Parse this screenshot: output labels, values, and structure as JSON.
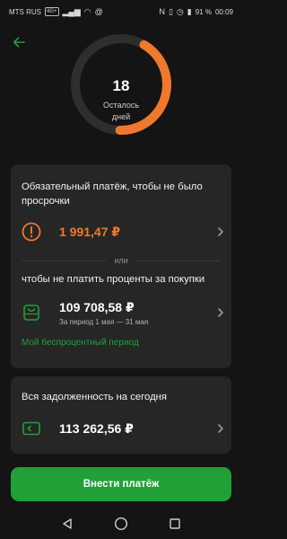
{
  "status_bar": {
    "carrier": "MTS RUS",
    "network_badge": "4G+",
    "battery": "91 %",
    "time": "00:09"
  },
  "header": {
    "back_icon": "back-arrow-icon"
  },
  "countdown": {
    "days": "18",
    "label": "Осталось\nдней",
    "progress_fraction": 0.42,
    "progress_color": "#f0782c",
    "track_color": "#2e2e2e"
  },
  "mandatory": {
    "title": "Обязательный платёж, чтобы не было просрочки",
    "amount": "1 991,47 ₽",
    "icon": "warning-circle-icon",
    "accent_color": "#f0782c"
  },
  "divider_text": "или",
  "interest_free": {
    "title": "чтобы не платить проценты за покупки",
    "amount": "109 708,58 ₽",
    "period": "За период 1 мая — 31 мая",
    "icon": "shopping-bag-icon",
    "link": "Мой беспроцентный период"
  },
  "total_debt": {
    "title": "Вся задолженность на сегодня",
    "amount": "113 262,56 ₽",
    "icon": "card-icon"
  },
  "pay_button": "Внести платёж",
  "colors": {
    "brand_green": "#21a038",
    "orange": "#f0782c",
    "background": "#141414",
    "card": "#262626"
  }
}
